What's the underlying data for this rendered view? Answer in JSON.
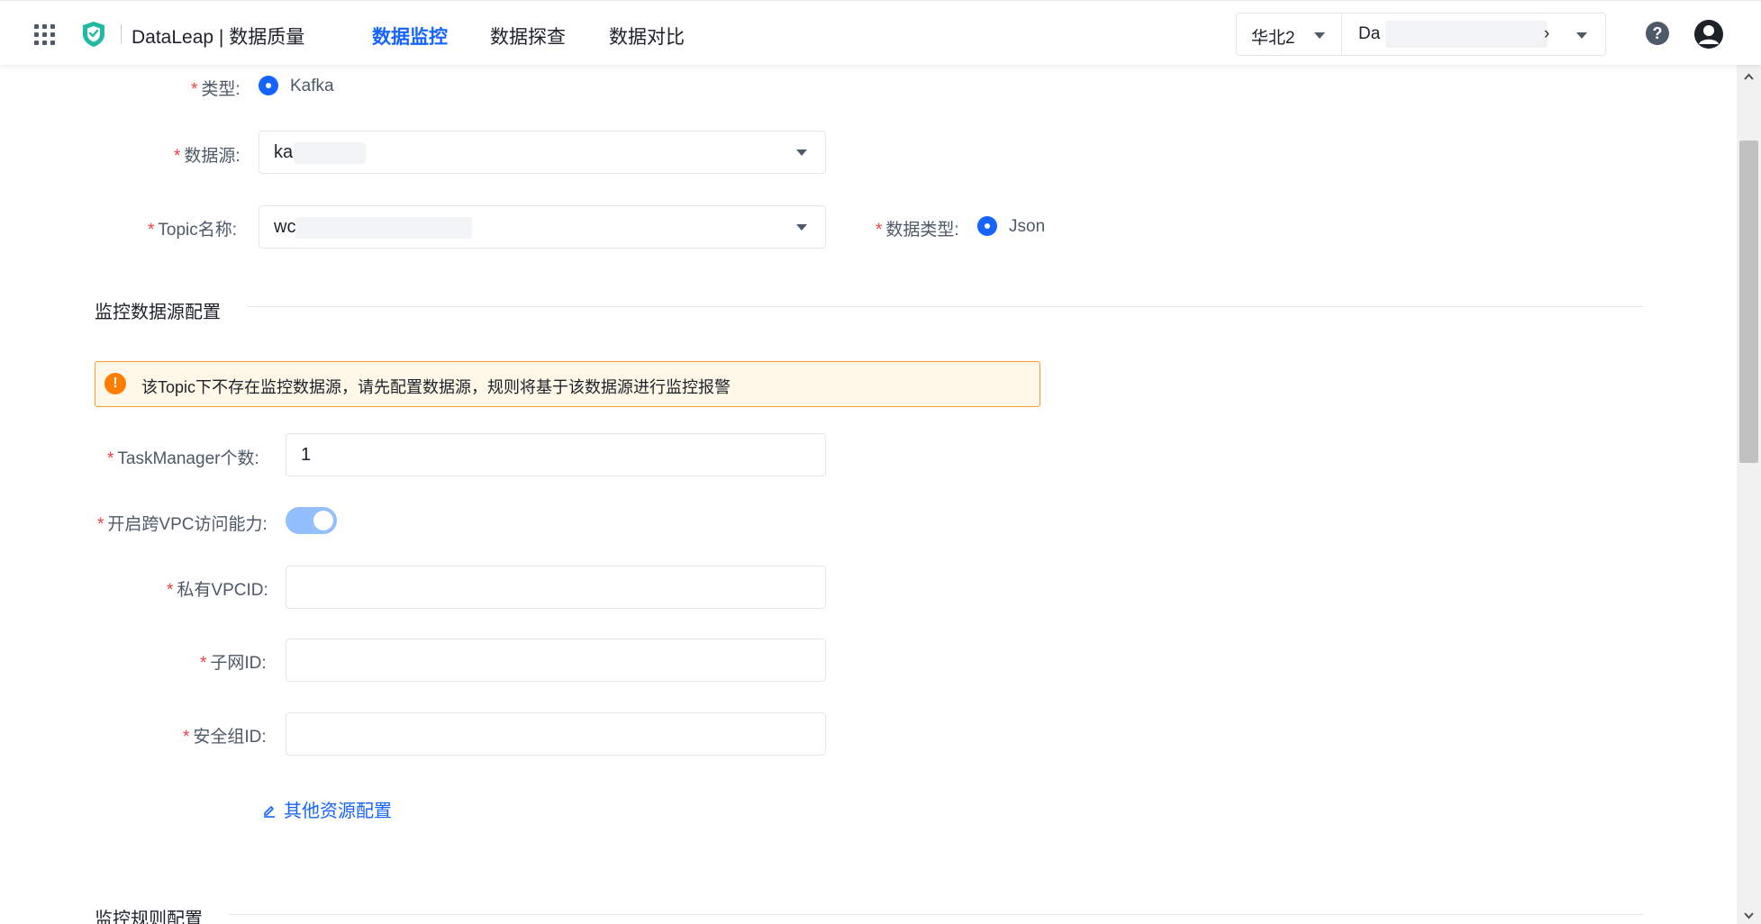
{
  "header": {
    "brand": "DataLeap | 数据质量",
    "tabs": [
      {
        "label": "数据监控",
        "active": true
      },
      {
        "label": "数据探查",
        "active": false
      },
      {
        "label": "数据对比",
        "active": false
      }
    ],
    "region": "华北2",
    "project": "Da",
    "project_suffix": "›",
    "help": "?"
  },
  "form": {
    "type": {
      "label": "类型:",
      "value": "Kafka"
    },
    "datasource": {
      "label": "数据源:",
      "value": "ka"
    },
    "topic": {
      "label": "Topic名称:",
      "value": "wc"
    },
    "data_type": {
      "label": "数据类型:",
      "value": "Json"
    }
  },
  "monitor_source": {
    "title": "监控数据源配置",
    "alert": "该Topic下不存在监控数据源，请先配置数据源，规则将基于该数据源进行监控报警",
    "task_manager": {
      "label": "TaskManager个数:",
      "value": "1"
    },
    "cross_vpc": {
      "label": "开启跨VPC访问能力:",
      "enabled": true
    },
    "vpc_id": {
      "label": "私有VPCID:",
      "value": ""
    },
    "subnet_id": {
      "label": "子网ID:",
      "value": ""
    },
    "security_group_id": {
      "label": "安全组ID:",
      "value": ""
    },
    "other_resources_link": "其他资源配置"
  },
  "monitor_rules": {
    "title": "监控规则配置"
  },
  "required_mark": "*",
  "colors": {
    "primary": "#1664ff",
    "required": "#f53f3f",
    "warning_bg": "#fff7e8",
    "warning_border": "#ff9a2e",
    "warning_icon": "#ff7d00",
    "toggle_on": "#94bfff"
  },
  "icons": [
    "apps-grid-icon",
    "shield-logo-icon",
    "chevron-down-icon",
    "help-icon",
    "user-avatar-icon",
    "warning-icon",
    "edit-icon",
    "scroll-up-icon",
    "scroll-down-icon"
  ]
}
